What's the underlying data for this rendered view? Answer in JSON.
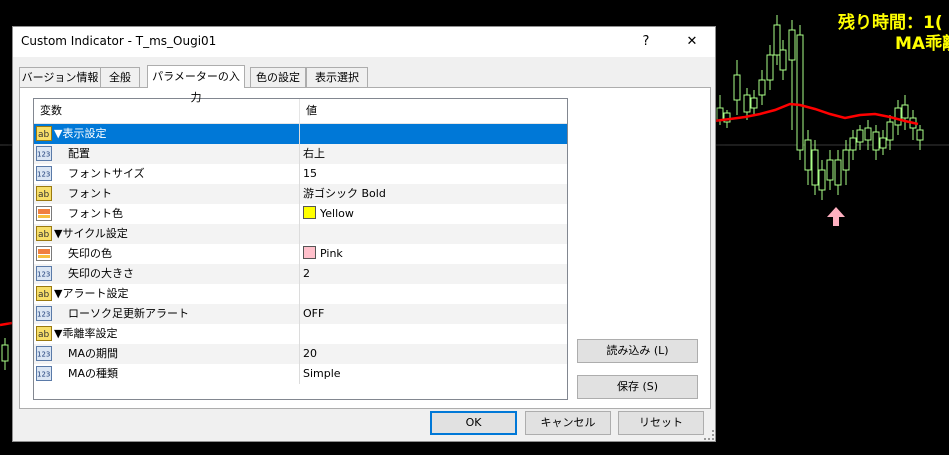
{
  "chart": {
    "overlay_line1": "残り時間：1(",
    "overlay_line2": "MA乖離",
    "colors": {
      "ma_line": "#ff0000",
      "candle": "#aaff88",
      "arrow": "#ffb0c0",
      "label": "#ffff00"
    }
  },
  "dialog": {
    "title": "Custom Indicator - T_ms_Ougi01",
    "help_label": "?",
    "close_label": "✕",
    "tabs": [
      {
        "label": "バージョン情報"
      },
      {
        "label": "全般"
      },
      {
        "label": "パラメーターの入力"
      },
      {
        "label": "色の設定"
      },
      {
        "label": "表示選択"
      }
    ],
    "active_tab_index": 2,
    "grid": {
      "col_name": "変数",
      "col_value": "値",
      "rows": [
        {
          "type": "ab",
          "name": "▼表示設定",
          "value": "",
          "level": 0
        },
        {
          "type": "123",
          "name": "配置",
          "value": "右上",
          "level": 1
        },
        {
          "type": "123",
          "name": "フォントサイズ",
          "value": "15",
          "level": 1
        },
        {
          "type": "ab",
          "name": "フォント",
          "value": "游ゴシック Bold",
          "level": 1
        },
        {
          "type": "color",
          "name": "フォント色",
          "value": "Yellow",
          "swatch": "#ffff00",
          "level": 1
        },
        {
          "type": "ab",
          "name": "▼サイクル設定",
          "value": "",
          "level": 0
        },
        {
          "type": "color",
          "name": "矢印の色",
          "value": "Pink",
          "swatch": "#ffc0cb",
          "level": 1
        },
        {
          "type": "123",
          "name": "矢印の大きさ",
          "value": "2",
          "level": 1
        },
        {
          "type": "ab",
          "name": "▼アラート設定",
          "value": "",
          "level": 0
        },
        {
          "type": "123",
          "name": "ローソク足更新アラート",
          "value": "OFF",
          "level": 1
        },
        {
          "type": "ab",
          "name": "▼乖離率設定",
          "value": "",
          "level": 0
        },
        {
          "type": "123",
          "name": "MAの期間",
          "value": "20",
          "level": 1
        },
        {
          "type": "123",
          "name": "MAの種類",
          "value": "Simple",
          "level": 1
        }
      ],
      "selected_row_index": 0
    },
    "load_label": "読み込み (L)",
    "save_label": "保存 (S)",
    "ok_label": "OK",
    "cancel_label": "キャンセル",
    "reset_label": "リセット"
  }
}
